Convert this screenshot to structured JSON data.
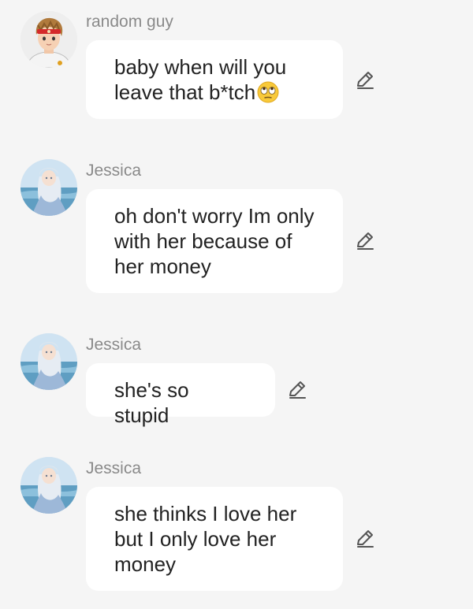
{
  "messages": [
    {
      "sender": "random guy",
      "text": "baby when will you\nleave that b*tch",
      "emoji": "face-with-rolling-eyes-icon",
      "avatar": "boy-avatar"
    },
    {
      "sender": "Jessica",
      "text": "oh don't worry Im only\nwith her because of\nher money",
      "avatar": "girl-avatar"
    },
    {
      "sender": "Jessica",
      "text": "she's so stupid",
      "avatar": "girl-avatar"
    },
    {
      "sender": "Jessica",
      "text": "she thinks I love her\nbut I only love her\nmoney",
      "avatar": "girl-avatar"
    }
  ],
  "colors": {
    "background": "#f5f5f5",
    "bubble": "#ffffff",
    "sender_text": "#8a8a8a",
    "message_text": "#222222",
    "icon": "#555555"
  },
  "icons": {
    "edit": "pencil-edit-icon"
  }
}
